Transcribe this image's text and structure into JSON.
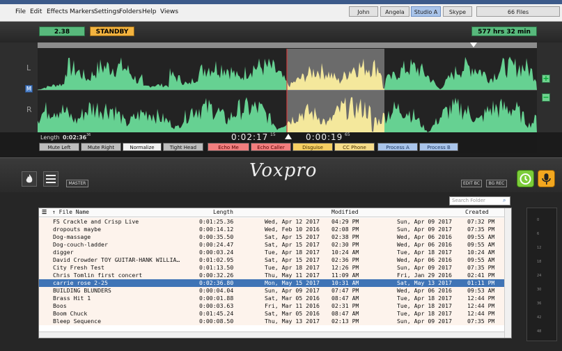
{
  "menu": [
    "File",
    "Edit",
    "Effects",
    "Markers",
    "Settings",
    "Folders",
    "Help",
    "Views"
  ],
  "users": [
    {
      "label": "John",
      "active": false
    },
    {
      "label": "Angela",
      "active": false
    },
    {
      "label": "Studio A",
      "active": true
    },
    {
      "label": "Skype",
      "active": false
    }
  ],
  "files_count": "66 Files",
  "header": {
    "left_value": "2.38",
    "status": "STANDBY",
    "right_value": "577 hrs  32 min"
  },
  "channels": {
    "left": "L",
    "right": "R",
    "mode_button": "M"
  },
  "timeline": {
    "length_label": "Length",
    "length_value": "0:02:36",
    "length_sup": "36",
    "cursor_time": "0:02:17",
    "cursor_sup": "15",
    "remain_time": "0:00:19",
    "remain_sup": "65"
  },
  "buttons": [
    {
      "label": "Mute Left",
      "style": "gray"
    },
    {
      "label": "Mute Right",
      "style": "gray"
    },
    {
      "label": "Normalize",
      "style": "white"
    },
    {
      "label": "Tight Head",
      "style": "gray"
    },
    {
      "label": "Echo Me",
      "style": "red"
    },
    {
      "label": "Echo Caller",
      "style": "red"
    },
    {
      "label": "Disguise",
      "style": "yellow"
    },
    {
      "label": "CC Phone",
      "style": "yellow"
    },
    {
      "label": "Process A",
      "style": "blue"
    },
    {
      "label": "Process B",
      "style": "blue"
    }
  ],
  "logo_text": "Voxpro",
  "master_label": "MASTER",
  "edit_bc": "EDIT BC",
  "bg_rec": "BG REC",
  "search_placeholder": "Search Folder",
  "columns": {
    "name": "↑ File Name",
    "length": "Length",
    "modified": "Modified",
    "created": "Created"
  },
  "files": [
    {
      "name": "FS Crackle and Crisp Live",
      "length": "0:01:25.36",
      "mod_date": "Wed, Apr 12 2017",
      "mod_time": "04:29 PM",
      "cr_date": "Sun, Apr 09 2017",
      "cr_time": "07:32 PM"
    },
    {
      "name": "dropouts maybe",
      "length": "0:00:14.12",
      "mod_date": "Wed, Feb 10 2016",
      "mod_time": "02:08 PM",
      "cr_date": "Sun, Apr 09 2017",
      "cr_time": "07:35 PM"
    },
    {
      "name": "Dog-massage",
      "length": "0:00:35.50",
      "mod_date": "Sat, Apr 15 2017",
      "mod_time": "02:38 PM",
      "cr_date": "Wed, Apr 06 2016",
      "cr_time": "09:55 AM"
    },
    {
      "name": "Dog-couch-ladder",
      "length": "0:00:24.47",
      "mod_date": "Sat, Apr 15 2017",
      "mod_time": "02:30 PM",
      "cr_date": "Wed, Apr 06 2016",
      "cr_time": "09:55 AM"
    },
    {
      "name": "digger",
      "length": "0:00:03.24",
      "mod_date": "Tue, Apr 18 2017",
      "mod_time": "10:24 AM",
      "cr_date": "Tue, Apr 18 2017",
      "cr_time": "10:24 AM"
    },
    {
      "name": "David Crowder TOY GUITAR-HANK WILLIA…",
      "length": "0:01:02.95",
      "mod_date": "Sat, Apr 15 2017",
      "mod_time": "02:36 PM",
      "cr_date": "Wed, Apr 06 2016",
      "cr_time": "09:55 AM"
    },
    {
      "name": "City Fresh Test",
      "length": "0:01:13.50",
      "mod_date": "Tue, Apr 18 2017",
      "mod_time": "12:26 PM",
      "cr_date": "Sun, Apr 09 2017",
      "cr_time": "07:35 PM"
    },
    {
      "name": "Chris Tomlin first concert",
      "length": "0:00:32.26",
      "mod_date": "Thu, May 11 2017",
      "mod_time": "11:09 AM",
      "cr_date": "Fri, Jan 29 2016",
      "cr_time": "02:41 PM"
    },
    {
      "name": "carrie rose 2-25",
      "length": "0:02:36.80",
      "mod_date": "Mon, May 15 2017",
      "mod_time": "10:31 AM",
      "cr_date": "Sat, May 13 2017",
      "cr_time": "01:11 PM",
      "selected": true
    },
    {
      "name": "BUILDING BLUNDERS",
      "length": "0:00:04.04",
      "mod_date": "Sun, Apr 09 2017",
      "mod_time": "07:47 PM",
      "cr_date": "Wed, Apr 06 2016",
      "cr_time": "09:53 AM"
    },
    {
      "name": "Brass Hit 1",
      "length": "0:00:01.88",
      "mod_date": "Sat, Mar 05 2016",
      "mod_time": "08:47 AM",
      "cr_date": "Tue, Apr 18 2017",
      "cr_time": "12:44 PM"
    },
    {
      "name": "Boos",
      "length": "0:00:03.63",
      "mod_date": "Fri, Mar 11 2016",
      "mod_time": "02:31 PM",
      "cr_date": "Tue, Apr 18 2017",
      "cr_time": "12:44 PM"
    },
    {
      "name": "Boom Chuck",
      "length": "0:01:45.24",
      "mod_date": "Sat, Mar 05 2016",
      "mod_time": "08:47 AM",
      "cr_date": "Tue, Apr 18 2017",
      "cr_time": "12:44 PM"
    },
    {
      "name": "Bleep Sequence",
      "length": "0:00:08.50",
      "mod_date": "Thu, May 13 2017",
      "mod_time": "02:13 PM",
      "cr_date": "Sun, Apr 09 2017",
      "cr_time": "07:35 PM"
    }
  ],
  "meter_ticks": [
    "0",
    "6",
    "12",
    "18",
    "24",
    "30",
    "36",
    "42",
    "48"
  ],
  "colors": {
    "wave": "#66d192",
    "wave_sel": "#f4e89c",
    "select_row": "#3f74b6",
    "playhead": "#d23c3c"
  }
}
